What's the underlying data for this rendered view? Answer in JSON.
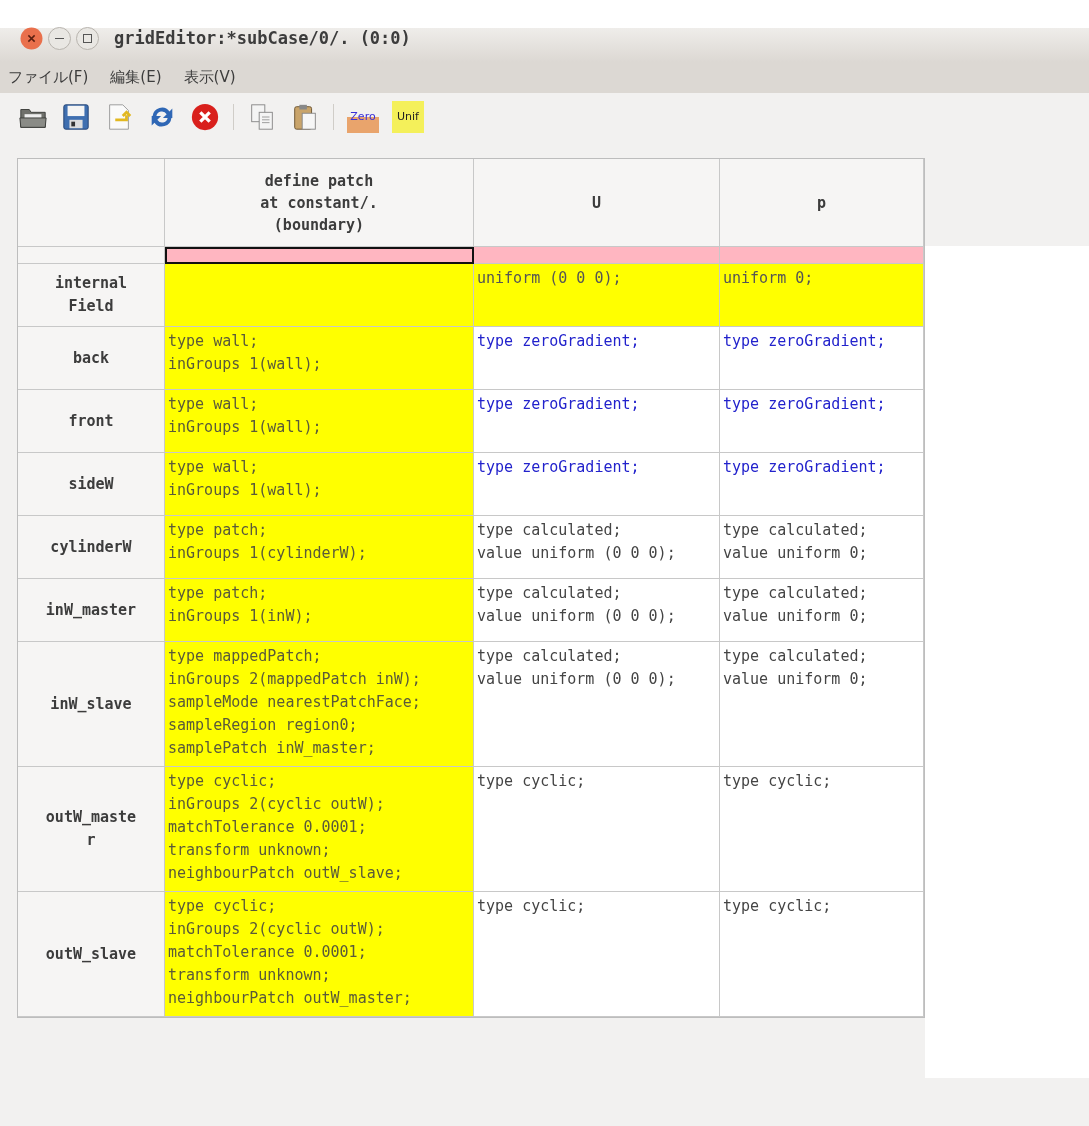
{
  "window": {
    "title": "gridEditor:*subCase/0/. (0:0)"
  },
  "menu": [
    "ファイル(F)",
    "編集(E)",
    "表示(V)"
  ],
  "toolbar": [
    {
      "kind": "open"
    },
    {
      "kind": "save"
    },
    {
      "kind": "saveas"
    },
    {
      "kind": "reload"
    },
    {
      "kind": "close"
    },
    {
      "kind": "sep"
    },
    {
      "kind": "copy"
    },
    {
      "kind": "paste"
    },
    {
      "kind": "sep"
    },
    {
      "kind": "zero",
      "label": "Zero"
    },
    {
      "kind": "unif",
      "label": "Unif"
    }
  ],
  "table": {
    "columns": [
      "define patch\nat constant/.\n(boundary)",
      "U",
      "p"
    ],
    "rows": [
      {
        "kind": "dims",
        "cells": [
          {
            "kind": "dims",
            "selected": true
          },
          {
            "kind": "dims",
            "selected": false
          },
          {
            "kind": "dims",
            "selected": false
          }
        ]
      },
      {
        "label": "internal\nField",
        "kind": "field",
        "cells": [
          {
            "kind": "patch",
            "selected": false
          },
          {
            "kind": "field",
            "text": "uniform (0 0 0);",
            "selected": false
          },
          {
            "kind": "field",
            "text": "uniform 0;",
            "selected": false
          }
        ]
      },
      {
        "label": "back",
        "cells": [
          {
            "kind": "patch",
            "text": "type wall;\ninGroups 1(wall);",
            "selected": false
          },
          {
            "kind": "zero",
            "text": "type zeroGradient;",
            "selected": false
          },
          {
            "kind": "zero",
            "text": "type zeroGradient;",
            "selected": false
          }
        ]
      },
      {
        "label": "front",
        "cells": [
          {
            "kind": "patch",
            "text": "type wall;\ninGroups 1(wall);",
            "selected": false
          },
          {
            "kind": "zero",
            "text": "type zeroGradient;",
            "selected": false
          },
          {
            "kind": "zero",
            "text": "type zeroGradient;",
            "selected": false
          }
        ]
      },
      {
        "label": "sideW",
        "cells": [
          {
            "kind": "patch",
            "text": "type wall;\ninGroups 1(wall);",
            "selected": false
          },
          {
            "kind": "zero",
            "text": "type zeroGradient;",
            "selected": false
          },
          {
            "kind": "zero",
            "text": "type zeroGradient;",
            "selected": false
          }
        ]
      },
      {
        "label": "cylinderW",
        "cells": [
          {
            "kind": "patch",
            "text": "type patch;\ninGroups 1(cylinderW);",
            "selected": false
          },
          {
            "kind": "plain",
            "text": "type calculated;\nvalue uniform (0 0 0);",
            "selected": false
          },
          {
            "kind": "plain",
            "text": "type calculated;\nvalue uniform 0;",
            "selected": false
          }
        ]
      },
      {
        "label": "inW_master",
        "cells": [
          {
            "kind": "patch",
            "text": "type patch;\ninGroups 1(inW);",
            "selected": false
          },
          {
            "kind": "plain",
            "text": "type calculated;\nvalue uniform (0 0 0);",
            "selected": false
          },
          {
            "kind": "plain",
            "text": "type calculated;\nvalue uniform 0;",
            "selected": false
          }
        ]
      },
      {
        "label": "inW_slave",
        "cells": [
          {
            "kind": "patch",
            "text": "type mappedPatch;\ninGroups 2(mappedPatch inW);\nsampleMode nearestPatchFace;\nsampleRegion region0;\nsamplePatch inW_master;",
            "selected": false
          },
          {
            "kind": "plain",
            "text": "type calculated;\nvalue uniform (0 0 0);",
            "selected": false
          },
          {
            "kind": "plain",
            "text": "type calculated;\nvalue uniform 0;",
            "selected": false
          }
        ]
      },
      {
        "label": "outW_maste\nr",
        "cells": [
          {
            "kind": "patch",
            "text": "type cyclic;\ninGroups 2(cyclic outW);\nmatchTolerance 0.0001;\ntransform unknown;\nneighbourPatch outW_slave;",
            "selected": false
          },
          {
            "kind": "plain",
            "text": "type cyclic;",
            "selected": false
          },
          {
            "kind": "plain",
            "text": "type cyclic;",
            "selected": false
          }
        ]
      },
      {
        "label": "outW_slave",
        "cells": [
          {
            "kind": "patch",
            "text": "type cyclic;\ninGroups 2(cyclic outW);\nmatchTolerance 0.0001;\ntransform unknown;\nneighbourPatch outW_master;",
            "selected": false
          },
          {
            "kind": "plain",
            "text": "type cyclic;",
            "selected": false
          },
          {
            "kind": "plain",
            "text": "type cyclic;",
            "selected": false
          }
        ]
      }
    ]
  }
}
